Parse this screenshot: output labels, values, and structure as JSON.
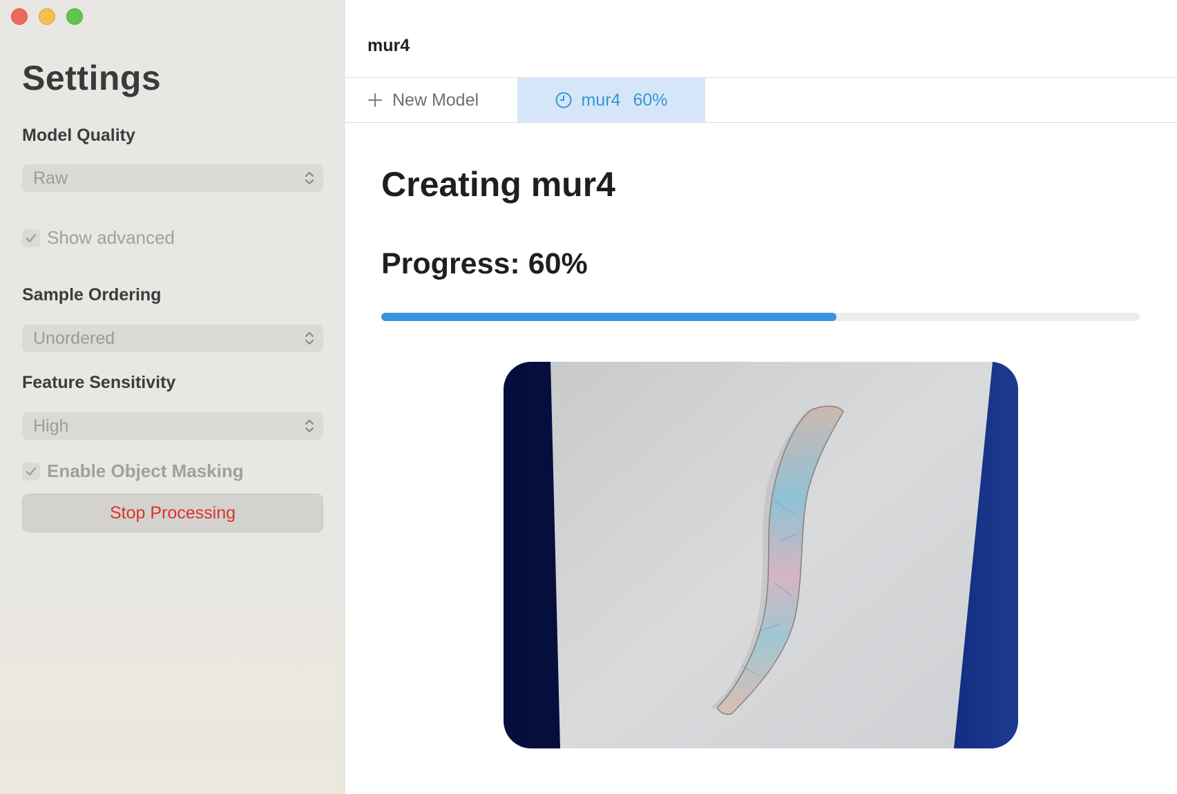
{
  "sidebar": {
    "title": "Settings",
    "model_quality": {
      "label": "Model Quality",
      "value": "Raw"
    },
    "show_advanced": {
      "label": "Show advanced",
      "checked": true
    },
    "sample_ordering": {
      "label": "Sample Ordering",
      "value": "Unordered"
    },
    "feature_sensitivity": {
      "label": "Feature Sensitivity",
      "value": "High"
    },
    "object_masking": {
      "label": "Enable Object Masking",
      "checked": true
    },
    "stop_button": "Stop Processing"
  },
  "window": {
    "title": "mur4"
  },
  "tabs": {
    "new_model": {
      "label": "New Model",
      "icon": "plus-icon"
    },
    "active": {
      "name": "mur4",
      "percent": "60%",
      "icon": "clock-icon"
    }
  },
  "main": {
    "heading": "Creating mur4",
    "progress_label": "Progress: 60%",
    "progress": 0.6
  },
  "colors": {
    "accent": "#3b91e2",
    "tab_active_bg": "#d5e6f9",
    "tab_active_text": "#3597d4",
    "stop_text": "#d9332b"
  }
}
